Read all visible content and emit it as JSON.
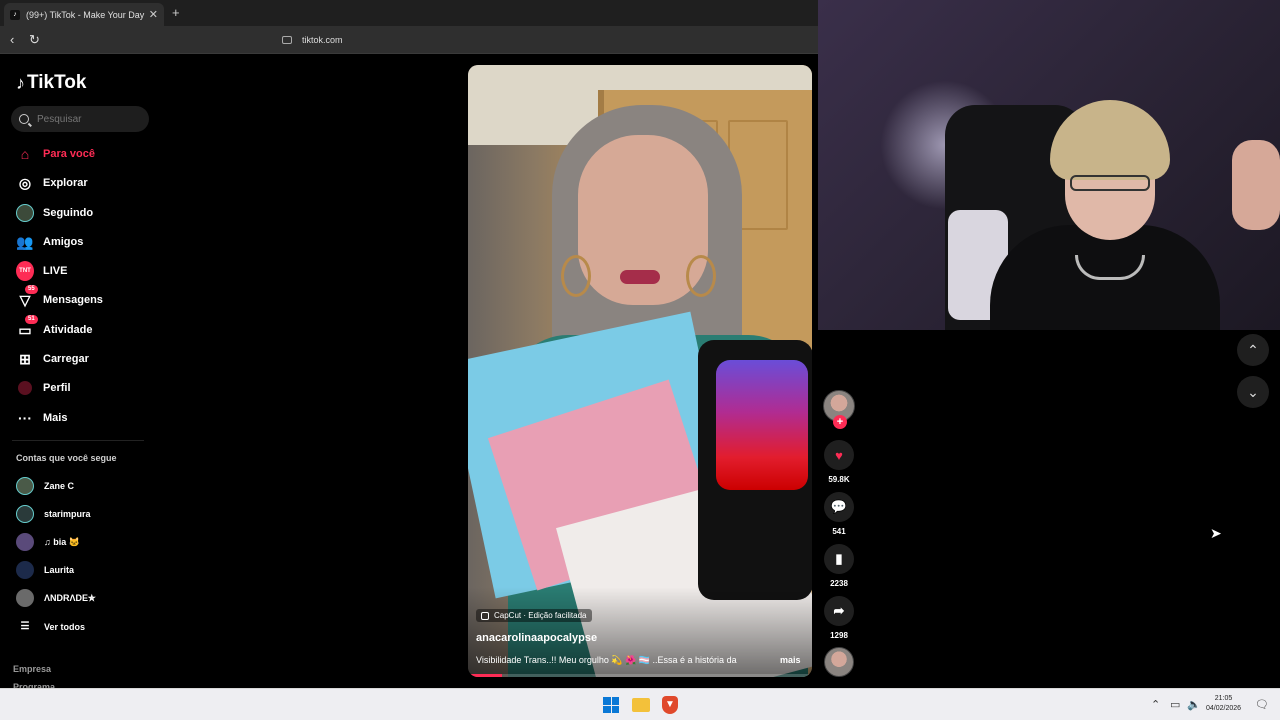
{
  "browser": {
    "tab_title": "(99+) TikTok - Make Your Day",
    "tab_close": "✕",
    "new_tab": "+",
    "url": "tiktok.com"
  },
  "sidebar": {
    "logo": "TikTok",
    "search_placeholder": "Pesquisar",
    "nav": [
      {
        "label": "Para você",
        "icon": "home-icon"
      },
      {
        "label": "Explorar",
        "icon": "compass-icon"
      },
      {
        "label": "Seguindo",
        "icon": "following-icon"
      },
      {
        "label": "Amigos",
        "icon": "friends-icon"
      },
      {
        "label": "LIVE",
        "icon": "live-icon"
      },
      {
        "label": "Mensagens",
        "icon": "messages-icon",
        "badge": "55"
      },
      {
        "label": "Atividade",
        "icon": "activity-icon",
        "badge": "51"
      },
      {
        "label": "Carregar",
        "icon": "upload-icon"
      },
      {
        "label": "Perfil",
        "icon": "profile-icon"
      },
      {
        "label": "Mais",
        "icon": "more-icon"
      }
    ],
    "following_title": "Contas que você segue",
    "following": [
      {
        "name": "Zane C",
        "color": "#4a5a48"
      },
      {
        "name": "starimpura",
        "color": "#2a3a3a"
      },
      {
        "name": "♫ bia 🐱",
        "color": "#5a4a7a"
      },
      {
        "name": "Laurita",
        "color": "#1c2a4a"
      },
      {
        "name": "ΛNDRΛDE✯",
        "color": "#6a6a6a"
      }
    ],
    "see_all": "Ver todos",
    "footer": [
      "Empresa",
      "Programa"
    ]
  },
  "video": {
    "capcut": "CapCut · Edição facilitada",
    "author": "anacarolinaapocalypse",
    "caption": "Visibilidade Trans..!! Meu orgulho 💫 🌺 🏳️‍⚧️ ..Essa é a história da",
    "more": "mais",
    "progress": 0.1
  },
  "actions": {
    "likes": "59.8K",
    "comments": "541",
    "saves": "2238",
    "shares": "1298"
  },
  "taskbar": {
    "time": "21:05",
    "date": "04/02/2026"
  },
  "colors": {
    "accent": "#fe2c55"
  }
}
